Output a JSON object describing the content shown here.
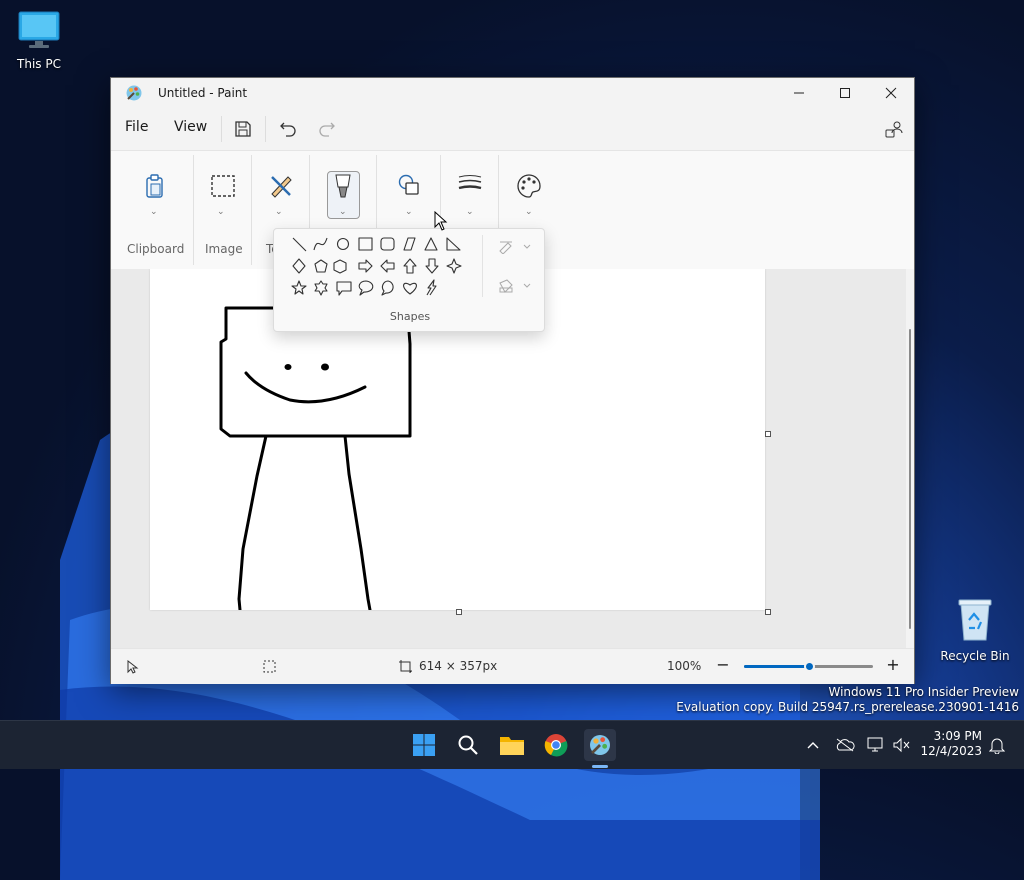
{
  "desktop": {
    "this_pc_label": "This PC",
    "recycle_bin_label": "Recycle Bin",
    "watermark_line1": "Windows 11 Pro Insider Preview",
    "watermark_line2": "Evaluation copy. Build 25947.rs_prerelease.230901-1416"
  },
  "window": {
    "title": "Untitled - Paint",
    "menu": {
      "file": "File",
      "view": "View"
    }
  },
  "ribbon": {
    "groups": {
      "clipboard": "Clipboard",
      "image": "Image",
      "tools": "Te"
    },
    "shapes_label": "Shapes"
  },
  "statusbar": {
    "canvas_size": "614 × 357px",
    "zoom": "100%",
    "zoom_level": 0.5
  },
  "taskbar": {
    "time": "3:09 PM",
    "date": "12/4/2023"
  },
  "icons": [
    "monitor-icon",
    "recycle-bin-icon",
    "paint-icon",
    "save-icon",
    "undo-icon",
    "redo-icon",
    "account-icon",
    "clipboard-icon",
    "select-icon",
    "tools-icon",
    "brush-icon",
    "shapes-icon",
    "line-weight-icon",
    "colors-icon",
    "outline-icon",
    "fill-icon",
    "pointer-icon",
    "selection-size-icon",
    "canvas-size-icon",
    "zoom-out-icon",
    "zoom-in-icon",
    "start-icon",
    "search-icon",
    "file-explorer-icon",
    "chrome-icon",
    "chevron-up-icon",
    "onedrive-icon",
    "network-icon",
    "volume-muted-icon",
    "bell-icon"
  ],
  "colors": {
    "accent": "#0067c0",
    "taskbar": "#1c2433"
  }
}
